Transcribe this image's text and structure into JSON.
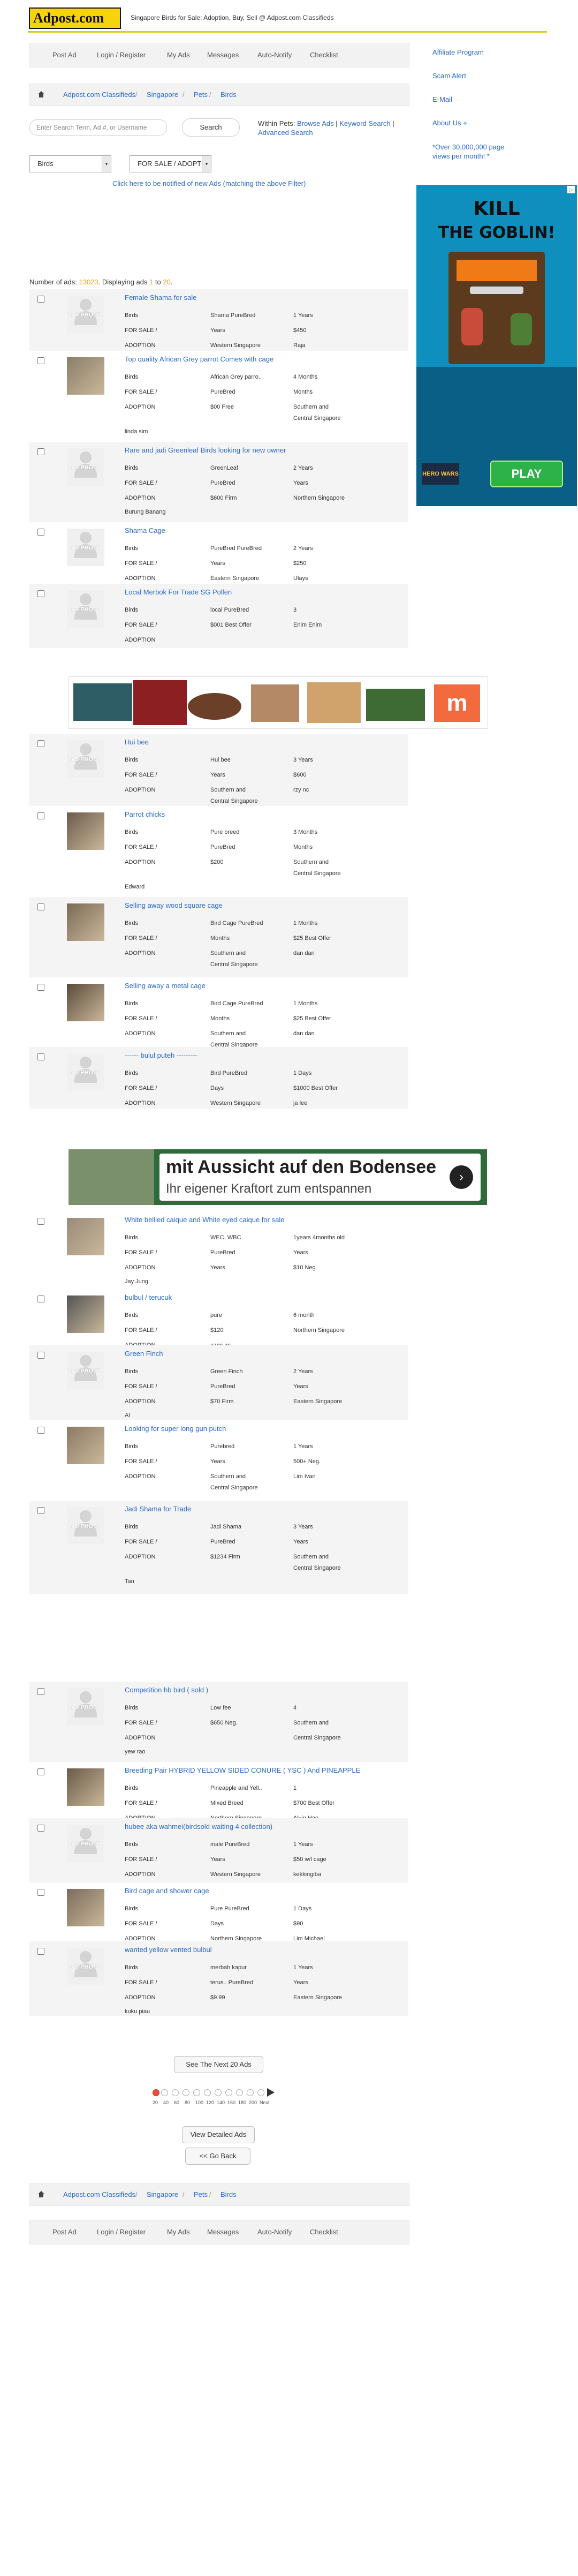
{
  "header": {
    "logo_text": "Adpost.com",
    "tagline": "Singapore Birds for Sale: Adoption, Buy, Sell @ Adpost.com Classifieds"
  },
  "topnav": {
    "items": [
      "Post Ad",
      "Login / Register",
      "My Ads",
      "Messages",
      "Auto-Notify",
      "Checklist"
    ]
  },
  "breadcrumbs": [
    "Adpost.com Classifieds",
    "Singapore",
    "Pets",
    "Birds"
  ],
  "right_links": [
    "Affiliate Program",
    "Scam Alert",
    "E-Mail",
    "About Us +"
  ],
  "promo": "*Over 30,000,000 page views per month! *",
  "game_ad": {
    "title_line1": "KILL",
    "title_line2": "THE GOBLIN!",
    "play_label": "PLAY",
    "brand": "HERO WARS"
  },
  "search": {
    "placeholder": "Enter Search Term, Ad #, or Username",
    "button_label": "Search",
    "within_label": "Within Pets:",
    "links": [
      "Browse Ads",
      "Keyword Search",
      "Advanced Search"
    ]
  },
  "filters": {
    "category_value": "Birds",
    "type_value": "FOR SALE / ADOPTION"
  },
  "notify_text": "Click here to be notified of new Ads (matching the above Filter)",
  "results": {
    "label": "Number of ads: ",
    "total": "13023",
    "displaying": ". Displaying ads ",
    "from": "1",
    "to_word": " to ",
    "to": "20",
    "end": "."
  },
  "listings": [
    {
      "title": "Female Shama for sale",
      "photo": false,
      "shade": true,
      "rows": [
        [
          "Birds",
          "Shama PureBred",
          "1 Years"
        ],
        [
          "FOR SALE /",
          "Years",
          "$450"
        ],
        [
          "ADOPTION",
          "Western Singapore",
          "Raja"
        ]
      ],
      "extra": ""
    },
    {
      "title": "Top quality African Grey parrot Comes with cage",
      "photo": true,
      "shade": false,
      "rows": [
        [
          "Birds",
          "African Grey parro..",
          "4 Months"
        ],
        [
          "FOR SALE /",
          "PureBred",
          "Months"
        ],
        [
          "ADOPTION",
          "$00 Free",
          "Southern and"
        ],
        [
          "",
          "",
          "Central Singapore"
        ]
      ],
      "extra": "linda sim"
    },
    {
      "title": "Rare and jadi Greenleaf Birds looking for new owner",
      "photo": false,
      "shade": true,
      "rows": [
        [
          "Birds",
          "GreenLeaf",
          "2 Years"
        ],
        [
          "FOR SALE /",
          "PureBred",
          "Years"
        ],
        [
          "ADOPTION",
          "$600 Firm",
          "Northern Singapore"
        ]
      ],
      "extra": "Burung Banang"
    },
    {
      "title": "Shama Cage",
      "photo": false,
      "shade": false,
      "rows": [
        [
          "Birds",
          "PureBred PureBred",
          "2 Years"
        ],
        [
          "FOR SALE /",
          "Years",
          "$250"
        ],
        [
          "ADOPTION",
          "Eastern Singapore",
          "Ulays"
        ]
      ],
      "extra": ""
    },
    {
      "title": "Local Merbok For Trade SG Pollen",
      "photo": false,
      "shade": true,
      "rows": [
        [
          "Birds",
          "local PureBred",
          "3"
        ],
        [
          "FOR SALE /",
          "$001 Best Offer",
          "Enim Enim"
        ],
        [
          "ADOPTION",
          "",
          ""
        ]
      ],
      "extra": ""
    },
    {
      "title": "Hui bee",
      "photo": false,
      "shade": true,
      "rows": [
        [
          "Birds",
          "Hui bee",
          "3 Years"
        ],
        [
          "FOR SALE /",
          "Years",
          "$600"
        ],
        [
          "ADOPTION",
          "Southern and",
          "rzy nc"
        ],
        [
          "",
          "Central Singapore",
          ""
        ]
      ],
      "extra": ""
    },
    {
      "title": "Parrot chicks",
      "photo": true,
      "shade": false,
      "rows": [
        [
          "Birds",
          "Pure breed",
          "3 Months"
        ],
        [
          "FOR SALE /",
          "PureBred",
          "Months"
        ],
        [
          "ADOPTION",
          "$200",
          "Southern and"
        ],
        [
          "",
          "",
          "Central Singapore"
        ]
      ],
      "extra": "Edward"
    },
    {
      "title": "Selling away wood square cage",
      "photo": true,
      "shade": true,
      "rows": [
        [
          "Birds",
          "Bird Cage PureBred",
          "1 Months"
        ],
        [
          "FOR SALE /",
          "Months",
          "$25 Best Offer"
        ],
        [
          "ADOPTION",
          "Southern and",
          "dan dan"
        ],
        [
          "",
          "Central Singapore",
          ""
        ]
      ],
      "extra": ""
    },
    {
      "title": "Selling away a metal cage",
      "photo": true,
      "shade": false,
      "rows": [
        [
          "Birds",
          "Bird Cage PureBred",
          "1 Months"
        ],
        [
          "FOR SALE /",
          "Months",
          "$25 Best Offer"
        ],
        [
          "ADOPTION",
          "Southern and",
          "dan dan"
        ],
        [
          "",
          "Central Singapore",
          ""
        ]
      ],
      "extra": ""
    },
    {
      "title": "------ bulul puteh ---------",
      "photo": false,
      "shade": true,
      "rows": [
        [
          "Birds",
          "Bird PureBred",
          "1 Days"
        ],
        [
          "FOR SALE /",
          "Days",
          "$1000 Best Offer"
        ],
        [
          "ADOPTION",
          "Western Singapore",
          "ja lee"
        ]
      ],
      "extra": ""
    },
    {
      "title": "White bellied caique and White eyed caique for sale",
      "photo": true,
      "shade": false,
      "rows": [
        [
          "Birds",
          "WEC, WBC",
          "1years 4months old"
        ],
        [
          "FOR SALE /",
          "PureBred",
          "Years"
        ],
        [
          "ADOPTION",
          "Years",
          "$10 Neg."
        ]
      ],
      "extra": "Jay Jung"
    },
    {
      "title": "bulbul / terucuk",
      "photo": true,
      "shade": false,
      "rows": [
        [
          "Birds",
          "pure",
          "6 month"
        ],
        [
          "FOR SALE /",
          "$120",
          "Northern Singapore"
        ],
        [
          "ADOPTION",
          "azmi mi",
          ""
        ]
      ],
      "extra": ""
    },
    {
      "title": "Green Finch",
      "photo": false,
      "shade": true,
      "rows": [
        [
          "Birds",
          "Green Finch",
          "2 Years"
        ],
        [
          "FOR SALE /",
          "PureBred",
          "Years"
        ],
        [
          "ADOPTION",
          "$70 Firm",
          "Eastern Singapore"
        ]
      ],
      "extra": "Al"
    },
    {
      "title": "Looking for super long gun putch",
      "photo": true,
      "shade": false,
      "rows": [
        [
          "Birds",
          "Purebred",
          "1 Years"
        ],
        [
          "FOR SALE /",
          "Years",
          "500+ Neg."
        ],
        [
          "ADOPTION",
          "Southern and",
          "Lim Ivan"
        ],
        [
          "",
          "Central Singapore",
          ""
        ]
      ],
      "extra": ""
    },
    {
      "title": "Jadi Shama for Trade",
      "photo": false,
      "shade": true,
      "rows": [
        [
          "Birds",
          "Jadi Shama",
          "3 Years"
        ],
        [
          "FOR SALE /",
          "PureBred",
          "Years"
        ],
        [
          "ADOPTION",
          "$1234 Firm",
          "Southern and"
        ],
        [
          "",
          "",
          "Central Singapore"
        ]
      ],
      "extra": "Tan"
    },
    {
      "title": "Competition hb bird ( sold )",
      "photo": false,
      "shade": true,
      "rows": [
        [
          "Birds",
          "Low fee",
          "4"
        ],
        [
          "FOR SALE /",
          "$650 Neg.",
          "Southern and"
        ],
        [
          "ADOPTION",
          "",
          "Central Singapore"
        ]
      ],
      "extra": "yew rao"
    },
    {
      "title": "Breeding Pair HYBRID YELLOW SIDED CONURE ( YSC ) And PINEAPPLE",
      "photo": true,
      "shade": false,
      "rows": [
        [
          "Birds",
          "Pineapple and Yell..",
          "1"
        ],
        [
          "FOR SALE /",
          "Mixed Breed",
          "$700 Best Offer"
        ],
        [
          "ADOPTION",
          "Northern Singapore",
          "Alvin Hao"
        ]
      ],
      "extra": ""
    },
    {
      "title": "hubee aka wahmei(birdsold waiting 4 collection)",
      "photo": false,
      "shade": true,
      "rows": [
        [
          "Birds",
          "male PureBred",
          "1 Years"
        ],
        [
          "FOR SALE /",
          "Years",
          "$50 w/l cage"
        ],
        [
          "ADOPTION",
          "Western Singapore",
          "kekkingiba"
        ]
      ],
      "extra": ""
    },
    {
      "title": "Bird cage and shower cage",
      "photo": true,
      "shade": false,
      "rows": [
        [
          "Birds",
          "Pure PureBred",
          "1 Days"
        ],
        [
          "FOR SALE /",
          "Days",
          "$90"
        ],
        [
          "ADOPTION",
          "Northern Singapore",
          "Lim Michael"
        ]
      ],
      "extra": ""
    },
    {
      "title": "wanted yellow vented bulbul",
      "photo": false,
      "shade": true,
      "rows": [
        [
          "Birds",
          "merbah kapur",
          "1 Years"
        ],
        [
          "FOR SALE /",
          "terus.. PureBred",
          "Years"
        ],
        [
          "ADOPTION",
          "$9.99",
          "Eastern Singapore"
        ]
      ],
      "extra": "kuku piau"
    }
  ],
  "banner1": {
    "label": "ad"
  },
  "banner2": {
    "line1": "mit Aussicht auf den Bodensee",
    "line2": "Ihr eigener Kraftort zum entspannen"
  },
  "bottom": {
    "next_label": "See The Next 20 Ads",
    "pager_labels": [
      "20",
      "40",
      "60",
      "80",
      "100",
      "120",
      "140",
      "160",
      "180",
      "200",
      "Next"
    ],
    "detailed_label": "View Detailed Ads",
    "back_label": "<< Go Back"
  }
}
